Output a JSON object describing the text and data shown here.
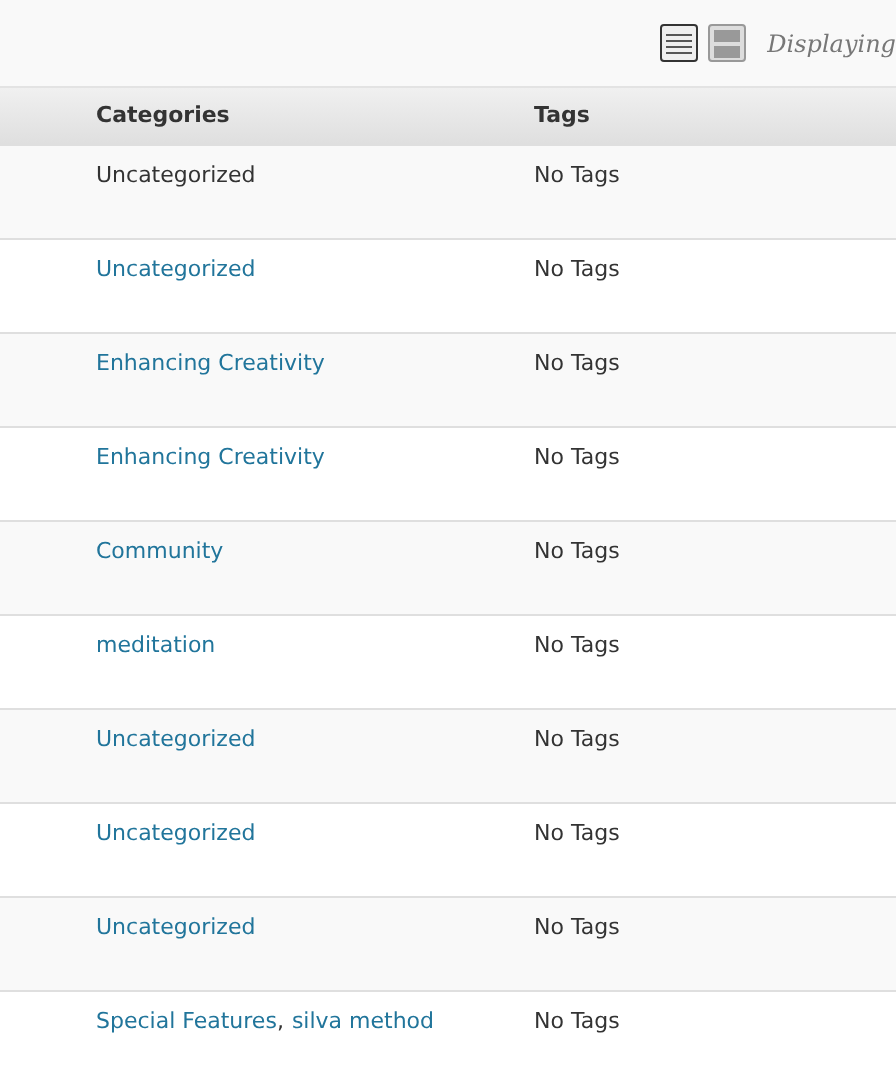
{
  "view_modes": [
    {
      "kind": "list",
      "selected": true
    },
    {
      "kind": "excerpt",
      "selected": false
    }
  ],
  "displaying": "Displaying",
  "table": {
    "columns": [
      "Categories",
      "Tags"
    ],
    "rows": [
      {
        "categories": [
          {
            "text": "Uncategorized",
            "kind": "plain"
          }
        ],
        "tags": "No Tags"
      },
      {
        "categories": [
          {
            "text": "Uncategorized",
            "kind": "link"
          }
        ],
        "tags": "No Tags"
      },
      {
        "categories": [
          {
            "text": "Enhancing Creativity",
            "kind": "link"
          }
        ],
        "tags": "No Tags"
      },
      {
        "categories": [
          {
            "text": "Enhancing Creativity",
            "kind": "link"
          }
        ],
        "tags": "No Tags"
      },
      {
        "categories": [
          {
            "text": "Community",
            "kind": "link"
          }
        ],
        "tags": "No Tags"
      },
      {
        "categories": [
          {
            "text": "meditation",
            "kind": "link"
          }
        ],
        "tags": "No Tags"
      },
      {
        "categories": [
          {
            "text": "Uncategorized",
            "kind": "link"
          }
        ],
        "tags": "No Tags"
      },
      {
        "categories": [
          {
            "text": "Uncategorized",
            "kind": "link"
          }
        ],
        "tags": "No Tags"
      },
      {
        "categories": [
          {
            "text": "Uncategorized",
            "kind": "link"
          }
        ],
        "tags": "No Tags"
      },
      {
        "categories": [
          {
            "text": "Special Features",
            "kind": "link"
          },
          {
            "text": ",",
            "kind": "plain"
          },
          {
            "text": "silva method",
            "kind": "link"
          }
        ],
        "tags": "No Tags"
      }
    ]
  }
}
